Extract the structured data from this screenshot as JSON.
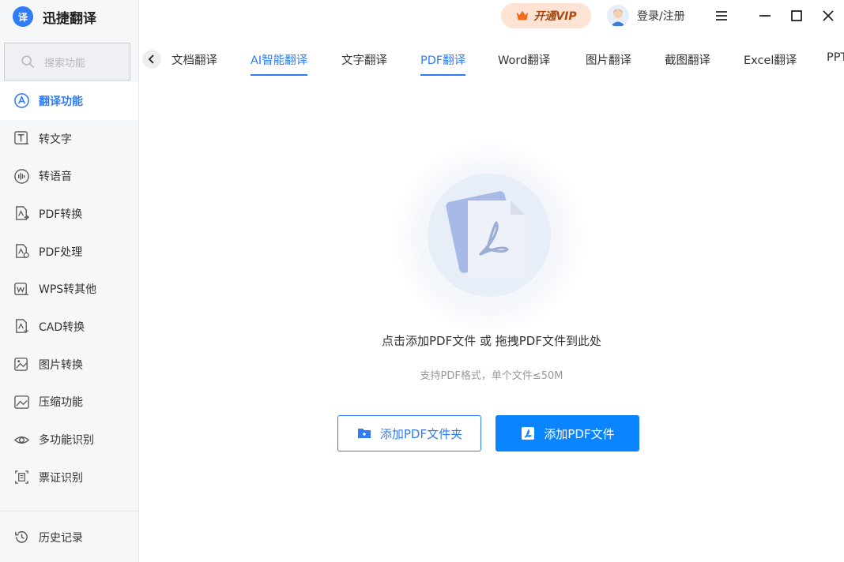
{
  "app": {
    "name": "迅捷翻译",
    "logo_char": "译"
  },
  "search": {
    "placeholder": "搜索功能"
  },
  "sidebar": {
    "items": [
      {
        "label": "翻译功能",
        "icon": "translate-icon",
        "active": true
      },
      {
        "label": "转文字",
        "icon": "text-convert-icon"
      },
      {
        "label": "转语音",
        "icon": "voice-icon"
      },
      {
        "label": "PDF转换",
        "icon": "pdf-convert-icon"
      },
      {
        "label": "PDF处理",
        "icon": "pdf-process-icon"
      },
      {
        "label": "WPS转其他",
        "icon": "wps-icon"
      },
      {
        "label": "CAD转换",
        "icon": "cad-icon"
      },
      {
        "label": "图片转换",
        "icon": "image-convert-icon"
      },
      {
        "label": "压缩功能",
        "icon": "compress-icon"
      },
      {
        "label": "多功能识别",
        "icon": "eye-icon"
      },
      {
        "label": "票证识别",
        "icon": "ticket-icon"
      }
    ],
    "history": {
      "label": "历史记录",
      "icon": "history-icon"
    }
  },
  "topbar": {
    "vip_label": "开通VIP",
    "login_label": "登录/注册"
  },
  "tabs": [
    {
      "label": "文档翻译"
    },
    {
      "label": "AI智能翻译",
      "underline": true
    },
    {
      "label": "文字翻译"
    },
    {
      "label": "PDF翻译",
      "active": true
    },
    {
      "label": "Word翻译"
    },
    {
      "label": "图片翻译"
    },
    {
      "label": "截图翻译"
    },
    {
      "label": "Excel翻译"
    },
    {
      "label": "PPT"
    }
  ],
  "main": {
    "headline": "点击添加PDF文件 或 拖拽PDF文件到此处",
    "subline": "支持PDF格式，单个文件≤50M",
    "add_folder_label": "添加PDF文件夹",
    "add_file_label": "添加PDF文件"
  },
  "colors": {
    "accent": "#2f7cf6",
    "primary_button": "#0a84ff",
    "vip_bg": "#fde3d4",
    "sidebar_bg": "#f6f7f9"
  }
}
